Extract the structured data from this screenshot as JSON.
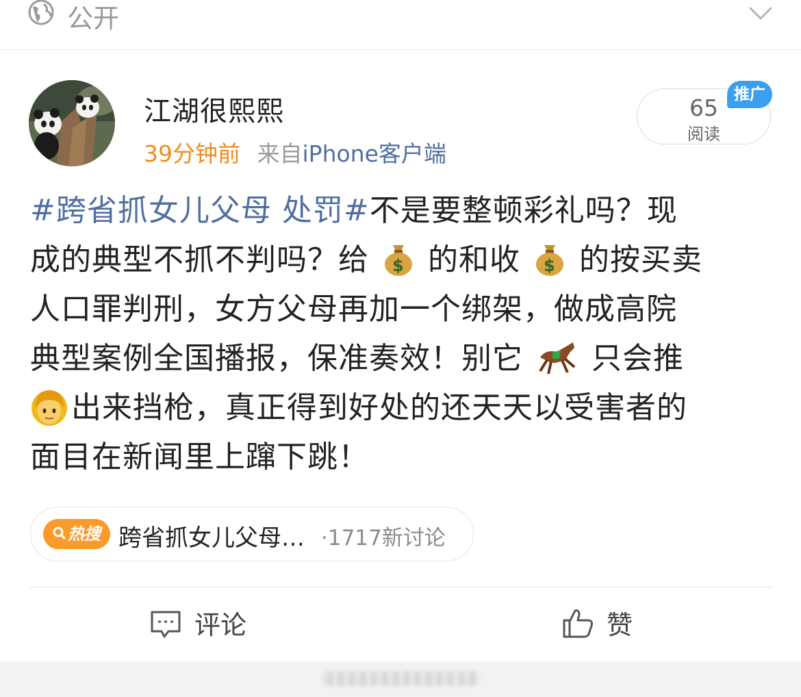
{
  "header": {
    "visibility_label": "公开",
    "globe_icon": "globe-icon",
    "expand_icon": "chevron-down-icon"
  },
  "post": {
    "username": "江湖很熙熙",
    "time": "39分钟前",
    "from_prefix": "来自",
    "client": "iPhone客户端",
    "read_count": "65",
    "read_label": "阅读",
    "promo_badge": "推广",
    "content_lines": [
      {
        "hashtag": "#跨省抓女儿父母 处罚#",
        "text": "不是要整顿彩礼吗？现"
      },
      {
        "a": "成的典型不抓不判吗？给",
        "b": "的和收",
        "c": "的按买卖"
      },
      {
        "text": "人口罪判刑，女方父母再加一个绑架，做成高院"
      },
      {
        "a": "典型案例全国播报，保准奏效！别它",
        "b": "只会推"
      },
      {
        "a": "出来挡枪，真正得到好处的还天天以受害者的"
      },
      {
        "text": "面目在新闻里上蹿下跳！"
      }
    ],
    "emojis": [
      "money-bag-icon",
      "money-bag-icon",
      "racehorse-icon",
      "woman-icon"
    ]
  },
  "hot_search": {
    "badge": "热搜",
    "title": "跨省抓女儿父母…",
    "count": "·1717新讨论"
  },
  "actions": {
    "comment_label": "评论",
    "like_label": "赞"
  },
  "colors": {
    "link_blue": "#4f6ea1",
    "time_orange": "#f28a1c",
    "promo_blue": "#3b9ff0",
    "hot_orange": "#fa9a28"
  }
}
